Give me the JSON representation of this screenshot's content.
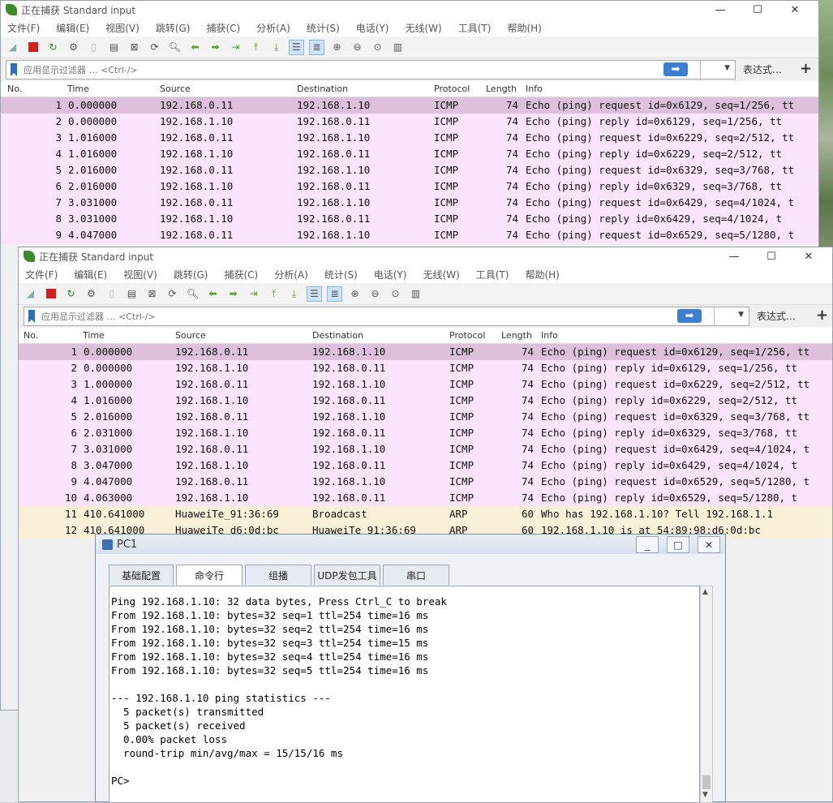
{
  "back_window": {
    "title": "正在捕获 Standard input",
    "menus": [
      "文件(F)",
      "编辑(E)",
      "视图(V)",
      "跳转(G)",
      "捕获(C)",
      "分析(A)",
      "统计(S)",
      "电话(Y)",
      "无线(W)",
      "工具(T)",
      "帮助(H)"
    ],
    "filter_placeholder": "应用显示过滤器 … <Ctrl-/>",
    "expression_label": "表达式…",
    "plus_label": "+",
    "columns": [
      "No.",
      "Time",
      "Source",
      "Destination",
      "Protocol",
      "Length",
      "Info"
    ],
    "rows": [
      {
        "no": "1",
        "time": "0.000000",
        "src": "192.168.0.11",
        "dst": "192.168.1.10",
        "proto": "ICMP",
        "len": "74",
        "info": "Echo (ping) request  id=0x6129, seq=1/256, tt"
      },
      {
        "no": "2",
        "time": "0.000000",
        "src": "192.168.1.10",
        "dst": "192.168.0.11",
        "proto": "ICMP",
        "len": "74",
        "info": "Echo (ping) reply    id=0x6129, seq=1/256, tt"
      },
      {
        "no": "3",
        "time": "1.016000",
        "src": "192.168.0.11",
        "dst": "192.168.1.10",
        "proto": "ICMP",
        "len": "74",
        "info": "Echo (ping) request  id=0x6229, seq=2/512, tt"
      },
      {
        "no": "4",
        "time": "1.016000",
        "src": "192.168.1.10",
        "dst": "192.168.0.11",
        "proto": "ICMP",
        "len": "74",
        "info": "Echo (ping) reply    id=0x6229, seq=2/512, tt"
      },
      {
        "no": "5",
        "time": "2.016000",
        "src": "192.168.0.11",
        "dst": "192.168.1.10",
        "proto": "ICMP",
        "len": "74",
        "info": "Echo (ping) request  id=0x6329, seq=3/768, tt"
      },
      {
        "no": "6",
        "time": "2.016000",
        "src": "192.168.1.10",
        "dst": "192.168.0.11",
        "proto": "ICMP",
        "len": "74",
        "info": "Echo (ping) reply    id=0x6329, seq=3/768, tt"
      },
      {
        "no": "7",
        "time": "3.031000",
        "src": "192.168.0.11",
        "dst": "192.168.1.10",
        "proto": "ICMP",
        "len": "74",
        "info": "Echo (ping) request  id=0x6429, seq=4/1024, t"
      },
      {
        "no": "8",
        "time": "3.031000",
        "src": "192.168.1.10",
        "dst": "192.168.0.11",
        "proto": "ICMP",
        "len": "74",
        "info": "Echo (ping) reply    id=0x6429, seq=4/1024, t"
      },
      {
        "no": "9",
        "time": "4.047000",
        "src": "192.168.0.11",
        "dst": "192.168.1.10",
        "proto": "ICMP",
        "len": "74",
        "info": "Echo (ping) request  id=0x6529, seq=5/1280, t"
      }
    ]
  },
  "front_window": {
    "title": "正在捕获 Standard input",
    "menus": [
      "文件(F)",
      "编辑(E)",
      "视图(V)",
      "跳转(G)",
      "捕获(C)",
      "分析(A)",
      "统计(S)",
      "电话(Y)",
      "无线(W)",
      "工具(T)",
      "帮助(H)"
    ],
    "filter_placeholder": "应用显示过滤器 … <Ctrl-/>",
    "expression_label": "表达式…",
    "plus_label": "+",
    "columns": [
      "No.",
      "Time",
      "Source",
      "Destination",
      "Protocol",
      "Length",
      "Info"
    ],
    "rows": [
      {
        "no": "1",
        "time": "0.000000",
        "src": "192.168.0.11",
        "dst": "192.168.1.10",
        "proto": "ICMP",
        "len": "74",
        "info": "Echo (ping) request  id=0x6129, seq=1/256, tt"
      },
      {
        "no": "2",
        "time": "0.000000",
        "src": "192.168.1.10",
        "dst": "192.168.0.11",
        "proto": "ICMP",
        "len": "74",
        "info": "Echo (ping) reply    id=0x6129, seq=1/256, tt"
      },
      {
        "no": "3",
        "time": "1.000000",
        "src": "192.168.0.11",
        "dst": "192.168.1.10",
        "proto": "ICMP",
        "len": "74",
        "info": "Echo (ping) request  id=0x6229, seq=2/512, tt"
      },
      {
        "no": "4",
        "time": "1.016000",
        "src": "192.168.1.10",
        "dst": "192.168.0.11",
        "proto": "ICMP",
        "len": "74",
        "info": "Echo (ping) reply    id=0x6229, seq=2/512, tt"
      },
      {
        "no": "5",
        "time": "2.016000",
        "src": "192.168.0.11",
        "dst": "192.168.1.10",
        "proto": "ICMP",
        "len": "74",
        "info": "Echo (ping) request  id=0x6329, seq=3/768, tt"
      },
      {
        "no": "6",
        "time": "2.031000",
        "src": "192.168.1.10",
        "dst": "192.168.0.11",
        "proto": "ICMP",
        "len": "74",
        "info": "Echo (ping) reply    id=0x6329, seq=3/768, tt"
      },
      {
        "no": "7",
        "time": "3.031000",
        "src": "192.168.0.11",
        "dst": "192.168.1.10",
        "proto": "ICMP",
        "len": "74",
        "info": "Echo (ping) request  id=0x6429, seq=4/1024, t"
      },
      {
        "no": "8",
        "time": "3.047000",
        "src": "192.168.1.10",
        "dst": "192.168.0.11",
        "proto": "ICMP",
        "len": "74",
        "info": "Echo (ping) reply    id=0x6429, seq=4/1024, t"
      },
      {
        "no": "9",
        "time": "4.047000",
        "src": "192.168.0.11",
        "dst": "192.168.1.10",
        "proto": "ICMP",
        "len": "74",
        "info": "Echo (ping) request  id=0x6529, seq=5/1280, t"
      },
      {
        "no": "10",
        "time": "4.063000",
        "src": "192.168.1.10",
        "dst": "192.168.0.11",
        "proto": "ICMP",
        "len": "74",
        "info": "Echo (ping) reply    id=0x6529, seq=5/1280, t"
      },
      {
        "no": "11",
        "time": "410.641000",
        "src": "HuaweiTe_91:36:69",
        "dst": "Broadcast",
        "proto": "ARP",
        "len": "60",
        "info": "Who has 192.168.1.10? Tell 192.168.1.1"
      },
      {
        "no": "12",
        "time": "410.641000",
        "src": "HuaweiTe_d6:0d:bc",
        "dst": "HuaweiTe_91:36:69",
        "proto": "ARP",
        "len": "60",
        "info": "192.168.1.10 is at 54:89:98:d6:0d:bc"
      }
    ]
  },
  "pc1_window": {
    "title": "PC1",
    "tabs": [
      "基础配置",
      "命令行",
      "组播",
      "UDP发包工具",
      "串口"
    ],
    "active_tab": "命令行",
    "terminal_lines": [
      "Ping 192.168.1.10: 32 data bytes, Press Ctrl_C to break",
      "From 192.168.1.10: bytes=32 seq=1 ttl=254 time=16 ms",
      "From 192.168.1.10: bytes=32 seq=2 ttl=254 time=16 ms",
      "From 192.168.1.10: bytes=32 seq=3 ttl=254 time=15 ms",
      "From 192.168.1.10: bytes=32 seq=4 ttl=254 time=16 ms",
      "From 192.168.1.10: bytes=32 seq=5 ttl=254 time=16 ms",
      "",
      "--- 192.168.1.10 ping statistics ---",
      "  5 packet(s) transmitted",
      "  5 packet(s) received",
      "  0.00% packet loss",
      "  round-trip min/avg/max = 15/15/16 ms",
      "",
      "PC>"
    ]
  }
}
